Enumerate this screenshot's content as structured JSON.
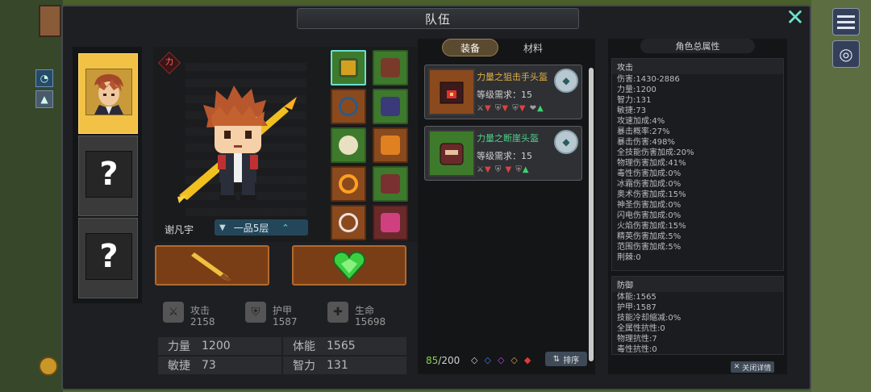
{
  "window": {
    "title": "队伍",
    "close_label": "✕"
  },
  "hero_slots": [
    {
      "state": "active"
    },
    {
      "state": "locked",
      "label": "?"
    },
    {
      "state": "locked",
      "label": "?"
    }
  ],
  "hero": {
    "class_badge": "力",
    "name": "谢凡宇",
    "rank": "一品5层"
  },
  "equipment_slots": [
    {
      "rarity": "green",
      "item": "helmet",
      "selected": true,
      "color": "#d4a020"
    },
    {
      "rarity": "green",
      "item": "armor",
      "color": "#7a3a2a"
    },
    {
      "rarity": "orange",
      "item": "necklace",
      "color": "#2a5a8a"
    },
    {
      "rarity": "green",
      "item": "bracer",
      "color": "#3a3a7a"
    },
    {
      "rarity": "green",
      "item": "pendant",
      "color": "#e8e0c0"
    },
    {
      "rarity": "orange",
      "item": "belt",
      "color": "#e08020"
    },
    {
      "rarity": "orange",
      "item": "ring",
      "color": "#ffa020"
    },
    {
      "rarity": "green",
      "item": "boots",
      "color": "#7a3030"
    },
    {
      "rarity": "orange",
      "item": "charm",
      "color": "#f0e0e0"
    },
    {
      "rarity": "red",
      "item": "mask",
      "color": "#d04080"
    }
  ],
  "stats": {
    "attack": {
      "label": "攻击",
      "value": "2158"
    },
    "armor": {
      "label": "护甲",
      "value": "1587"
    },
    "life": {
      "label": "生命",
      "value": "15698"
    }
  },
  "attributes": [
    {
      "label": "力量",
      "value": "1200"
    },
    {
      "label": "体能",
      "value": "1565"
    },
    {
      "label": "敏捷",
      "value": "73"
    },
    {
      "label": "智力",
      "value": "131"
    }
  ],
  "tabs": {
    "equip": "装备",
    "material": "材料"
  },
  "items": [
    {
      "name": "力量之狙击手头盔",
      "level": "等级需求：15",
      "quality": "orange"
    },
    {
      "name": "力量之断崖头盔",
      "level": "等级需求：15",
      "quality": "green"
    }
  ],
  "inventory": {
    "current": "85",
    "max": "/200",
    "sort_label": "排序"
  },
  "total_attributes": {
    "title": "角色总属性",
    "attack_header": "攻击",
    "attack_lines": [
      "伤害:1430-2886",
      "力量:1200",
      "智力:131",
      "敏捷:73",
      "攻速加成:4%",
      "暴击概率:27%",
      "暴击伤害:498%",
      "全技能伤害加成:20%",
      "物理伤害加成:41%",
      "毒性伤害加成:0%",
      "冰霜伤害加成:0%",
      "奥术伤害加成:15%",
      "神圣伤害加成:0%",
      "闪电伤害加成:0%",
      "火焰伤害加成:15%",
      "精英伤害加成:5%",
      "范围伤害加成:5%",
      "荆棘:0"
    ],
    "defense_header": "防御",
    "defense_lines": [
      "体能:1565",
      "护甲:1587",
      "技能冷却缩减:0%",
      "全属性抗性:0",
      "物理抗性:7",
      "毒性抗性:0"
    ],
    "close_label": "关闭详情"
  }
}
